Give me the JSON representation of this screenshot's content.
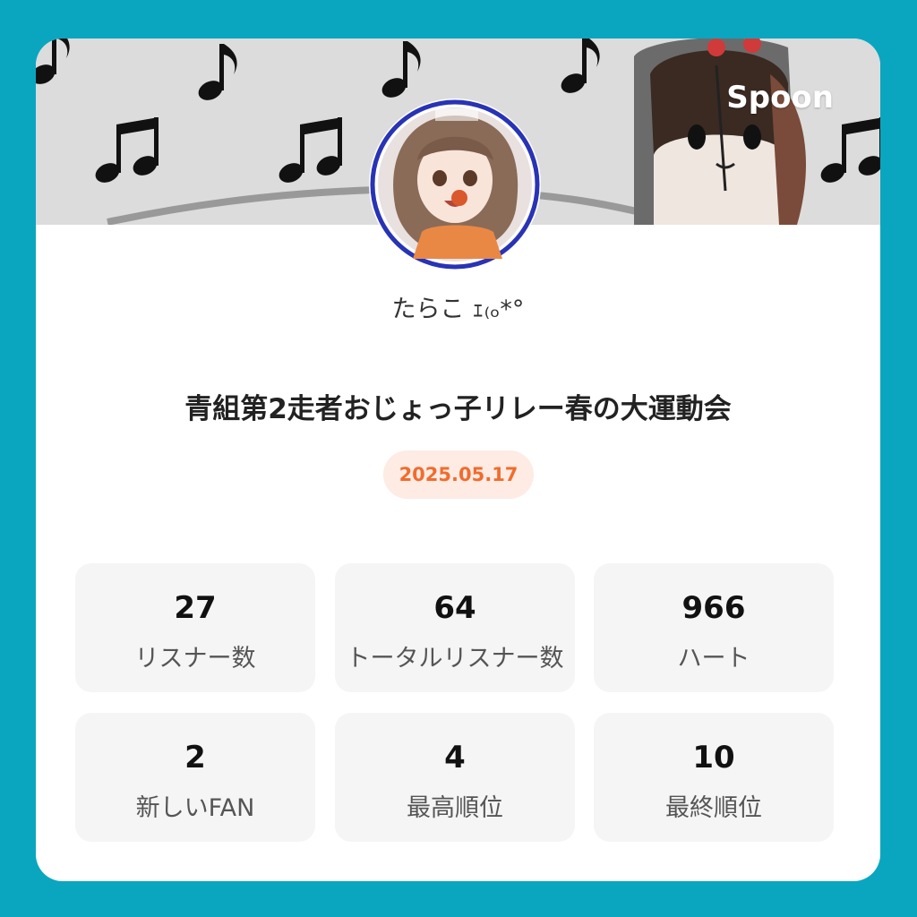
{
  "brand": {
    "name": "Spoon"
  },
  "profile": {
    "username": "たらこ ｪ₍ₒ*° "
  },
  "broadcast": {
    "title": "青組第2走者おじょっ子リレー春の大運動会",
    "date": "2025.05.17"
  },
  "colors": {
    "background": "#0aa6c0",
    "card": "#ffffff",
    "date_text": "#f06c2d",
    "date_pill": "#fdebe4",
    "stat_tile": "#f5f5f5"
  },
  "stats": [
    {
      "value": "27",
      "label": "リスナー数"
    },
    {
      "value": "64",
      "label": "トータルリスナー数"
    },
    {
      "value": "966",
      "label": "ハート"
    },
    {
      "value": "2",
      "label": "新しいFAN"
    },
    {
      "value": "4",
      "label": "最高順位"
    },
    {
      "value": "10",
      "label": "最終順位"
    }
  ]
}
